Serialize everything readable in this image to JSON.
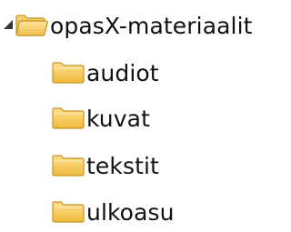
{
  "tree": {
    "root": {
      "label": "opasX-materiaalit",
      "expanded": true,
      "expander_icon": "triangle-down-icon",
      "icon": "folder-open-icon"
    },
    "children": [
      {
        "label": "audiot",
        "icon": "folder-icon"
      },
      {
        "label": "kuvat",
        "icon": "folder-icon"
      },
      {
        "label": "tekstit",
        "icon": "folder-icon"
      },
      {
        "label": "ulkoasu",
        "icon": "folder-icon"
      }
    ]
  },
  "colors": {
    "folder_fill": "#f5c64c",
    "folder_edge": "#c79522",
    "expander": "#333333"
  }
}
